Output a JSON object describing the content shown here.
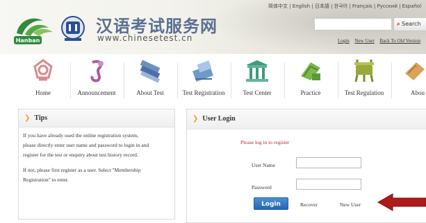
{
  "header": {
    "title": "汉语考试服务网",
    "url": "www.chinesetest.cn",
    "logo_text": "Hanban",
    "languages": "简体中文 | English | 日本語 | 한국어 | Français | Русский | Español",
    "search_label": "Search",
    "links": [
      "Login",
      "New User",
      "Back To Old Version"
    ]
  },
  "nav": {
    "items": [
      {
        "label": "Home",
        "icon": "knot-icon"
      },
      {
        "label": "Announcement",
        "icon": "scroll-icon"
      },
      {
        "label": "About Test",
        "icon": "books-icon"
      },
      {
        "label": "Test Registration",
        "icon": "registration-icon"
      },
      {
        "label": "Test Center",
        "icon": "building-icon"
      },
      {
        "label": "Practice",
        "icon": "practice-icon"
      },
      {
        "label": "Test Regulation",
        "icon": "bronze-vessel-icon"
      },
      {
        "label": "Abou",
        "icon": "about-icon"
      }
    ]
  },
  "tips": {
    "title": "Tips",
    "paragraph1_lines": [
      "If you have already used the online registration system,",
      "please directly enter user name and password to login in and",
      "register for the test or enquiry about test history record."
    ],
    "paragraph2_lines": [
      "If not, please first register as a user. Select \"Membership",
      "Registration\" to enter."
    ]
  },
  "login": {
    "title": "User Login",
    "prompt": "Please log in to register",
    "username_label": "User Name",
    "password_label": "Password",
    "username_value": "",
    "password_value": "",
    "login_button": "Login",
    "recover_link": "Recover",
    "new_user_link": "New User"
  },
  "colors": {
    "title_blue": "#5a6f91",
    "prompt_red": "#c0272d",
    "button_blue": "#2566b4",
    "arrow_red": "#b01a1a",
    "chevron_orange": "#f0a020"
  }
}
